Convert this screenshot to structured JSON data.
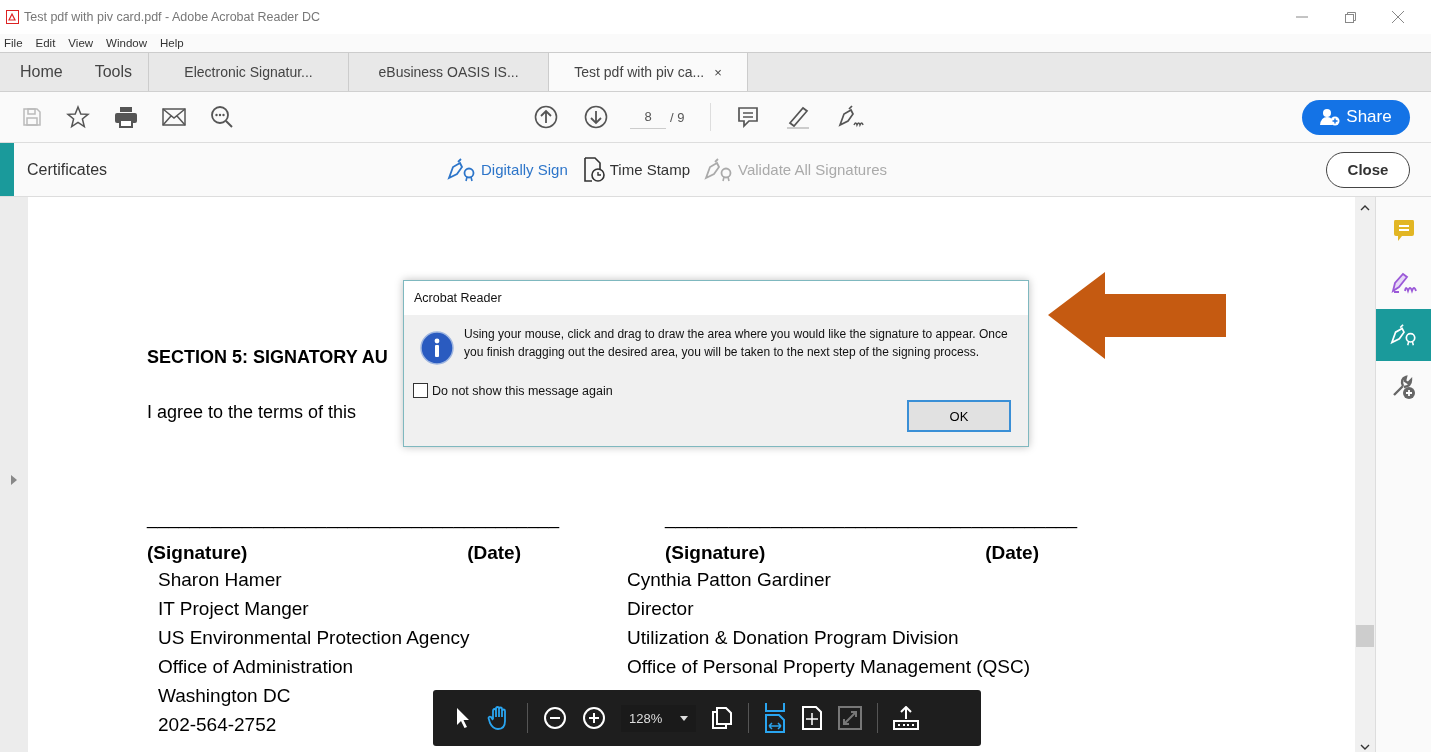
{
  "window": {
    "title": "Test pdf with piv card.pdf - Adobe Acrobat Reader DC"
  },
  "menu": [
    "File",
    "Edit",
    "View",
    "Window",
    "Help"
  ],
  "tabs": [
    {
      "label": "Home",
      "kind": "nav",
      "selected": false
    },
    {
      "label": "Tools",
      "kind": "nav",
      "selected": false
    },
    {
      "label": "Electronic Signatur...",
      "kind": "doc",
      "selected": false
    },
    {
      "label": "eBusiness OASIS IS...",
      "kind": "doc",
      "selected": false
    },
    {
      "label": "Test pdf with piv ca...",
      "kind": "doc",
      "selected": true,
      "close": "×"
    }
  ],
  "toolbar": {
    "page_current": "8",
    "page_total": "/ 9",
    "share": "Share"
  },
  "tool_panel": {
    "title": "Certificates",
    "actions": [
      {
        "label": "Digitally Sign",
        "kind": "sign",
        "active": true,
        "disabled": false
      },
      {
        "label": "Time Stamp",
        "kind": "stamp",
        "active": false,
        "disabled": false
      },
      {
        "label": "Validate All Signatures",
        "kind": "validate",
        "active": false,
        "disabled": true
      }
    ],
    "close": "Close"
  },
  "document": {
    "heading": "SECTION 5: SIGNATORY AU",
    "sentence": "I agree to the terms of this",
    "signatories": [
      {
        "rule": "_______________________________________",
        "signature_label": "(Signature)",
        "date_label": "(Date)",
        "lines": [
          "Sharon Hamer",
          "IT Project Manger",
          "US Environmental Protection Agency",
          "Office of Administration",
          "Washington DC",
          "202-564-2752"
        ]
      },
      {
        "rule": "_______________________________________",
        "signature_label": "(Signature)",
        "date_label": "(Date)",
        "lines": [
          "Cynthia Patton Gardiner",
          "Director",
          "Utilization & Donation Program Division",
          "Office of Personal Property Management (QSC)"
        ]
      }
    ]
  },
  "dialog": {
    "title": "Acrobat Reader",
    "message": "Using your mouse, click and drag to draw the area where you would like the signature to appear. Once you finish dragging out the desired area, you will be taken to the next step of the signing process.",
    "checkbox": {
      "label": "Do not show this message again",
      "checked": false
    },
    "ok": "OK"
  },
  "right_rail": [
    {
      "kind": "comment",
      "selected": false
    },
    {
      "kind": "fill-sign",
      "selected": false
    },
    {
      "kind": "certificates",
      "selected": true
    },
    {
      "kind": "more-tools",
      "selected": false
    }
  ],
  "floating_toolbar": {
    "zoom": "128%",
    "tools": [
      {
        "kind": "select",
        "selected": false,
        "disabled": false
      },
      {
        "kind": "hand",
        "selected": true,
        "disabled": false
      },
      {
        "kind": "sep"
      },
      {
        "kind": "zoom-out",
        "selected": false,
        "disabled": false
      },
      {
        "kind": "zoom-in",
        "selected": false,
        "disabled": false
      },
      {
        "kind": "zoom"
      },
      {
        "kind": "pages",
        "selected": false,
        "disabled": false
      },
      {
        "kind": "sep"
      },
      {
        "kind": "fit-width",
        "selected": true,
        "disabled": false
      },
      {
        "kind": "fit-page",
        "selected": false,
        "disabled": false
      },
      {
        "kind": "full-screen",
        "selected": false,
        "disabled": true
      },
      {
        "kind": "sep"
      },
      {
        "kind": "export",
        "selected": false,
        "disabled": false
      }
    ]
  }
}
